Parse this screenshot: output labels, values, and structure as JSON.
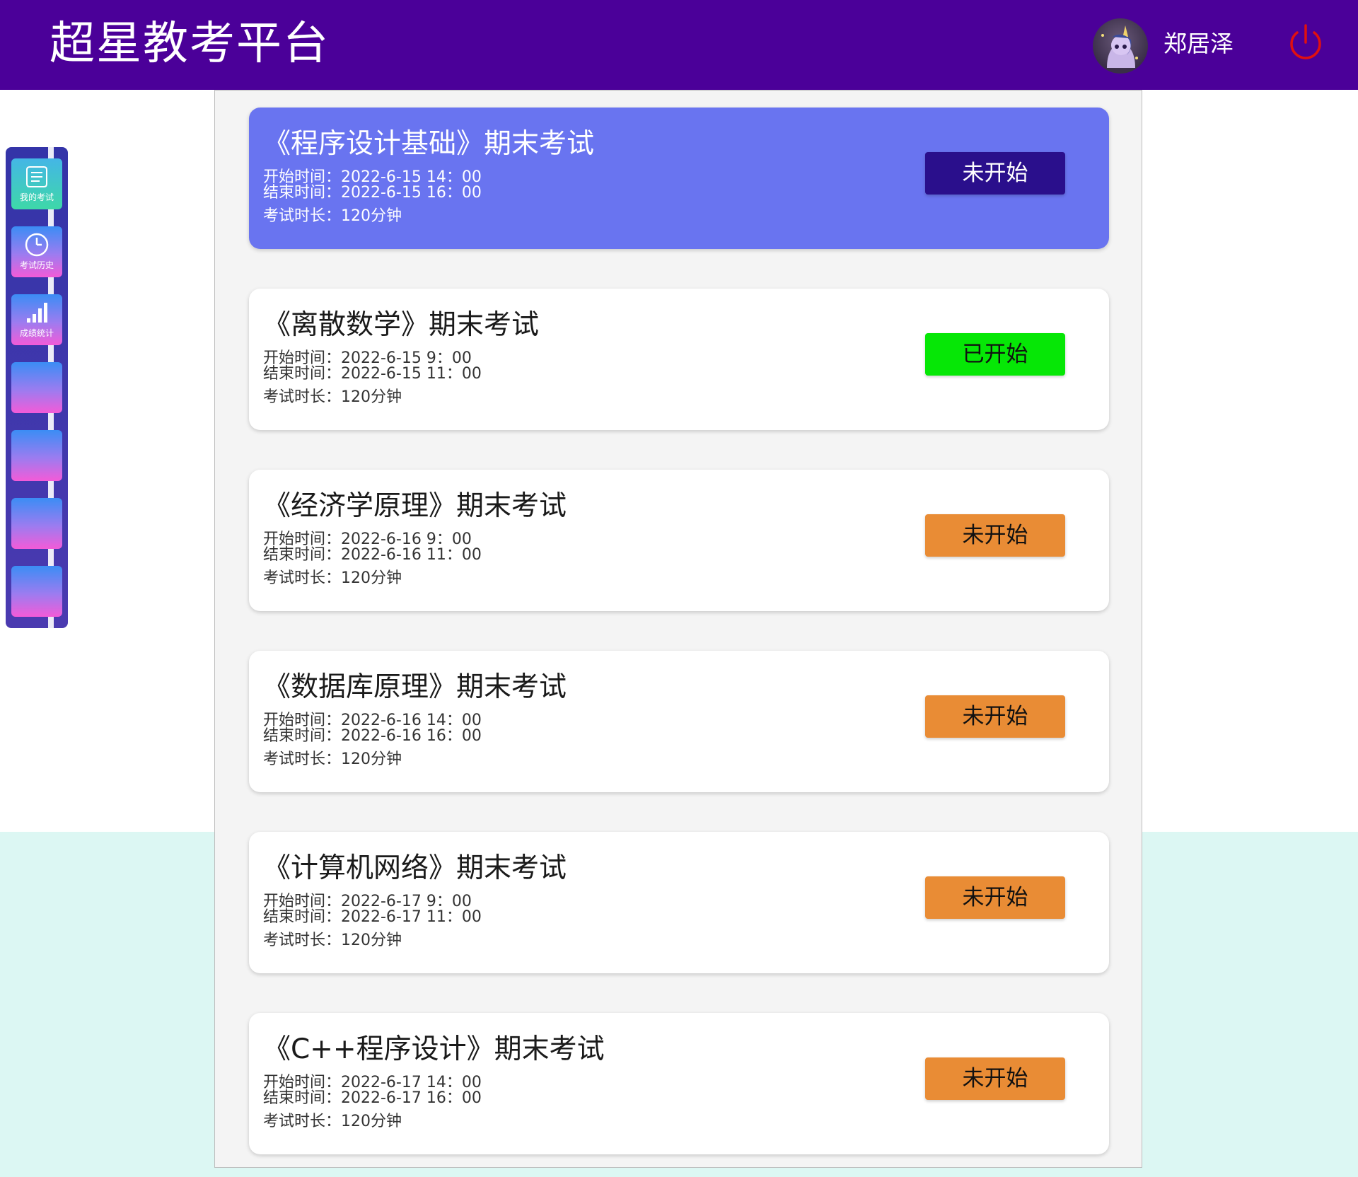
{
  "header": {
    "title": "超星教考平台",
    "username": "郑居泽"
  },
  "sidebar": {
    "items": [
      {
        "label": "我的考试",
        "icon": "scroll-icon"
      },
      {
        "label": "考试历史",
        "icon": "clock-icon"
      },
      {
        "label": "成绩统计",
        "icon": "bar-chart-icon"
      },
      {
        "label": ""
      },
      {
        "label": ""
      },
      {
        "label": ""
      },
      {
        "label": ""
      }
    ]
  },
  "exams": [
    {
      "title": "《程序设计基础》期末考试",
      "start": "开始时间：2022-6-15 14：00",
      "end": "结束时间：2022-6-15 16：00",
      "duration": "考试时长：120分钟",
      "status": "未开始",
      "status_color": "#2a0f8c"
    },
    {
      "title": "《离散数学》期末考试",
      "start": "开始时间：2022-6-15 9：00",
      "end": "结束时间：2022-6-15 11：00",
      "duration": "考试时长：120分钟",
      "status": "已开始",
      "status_color": "#06e706"
    },
    {
      "title": "《经济学原理》期末考试",
      "start": "开始时间：2022-6-16 9：00",
      "end": "结束时间：2022-6-16 11：00",
      "duration": "考试时长：120分钟",
      "status": "未开始",
      "status_color": "#e98c35"
    },
    {
      "title": "《数据库原理》期末考试",
      "start": "开始时间：2022-6-16 14：00",
      "end": "结束时间：2022-6-16 16：00",
      "duration": "考试时长：120分钟",
      "status": "未开始",
      "status_color": "#e98c35"
    },
    {
      "title": "《计算机网络》期末考试",
      "start": "开始时间：2022-6-17 9：00",
      "end": "结束时间：2022-6-17 11：00",
      "duration": "考试时长：120分钟",
      "status": "未开始",
      "status_color": "#e98c35"
    },
    {
      "title": "《C++程序设计》期末考试",
      "start": "开始时间：2022-6-17 14：00",
      "end": "结束时间：2022-6-17 16：00",
      "duration": "考试时长：120分钟",
      "status": "未开始",
      "status_color": "#e98c35"
    }
  ],
  "colors": {
    "header_bg": "#4b0099",
    "active_card": "#6974f0",
    "power_icon": "#e01010"
  }
}
